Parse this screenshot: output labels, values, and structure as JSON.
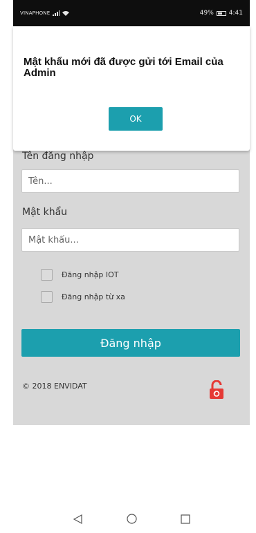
{
  "status_bar": {
    "carrier": "VINAPHONE",
    "battery": "49%",
    "time": "4:41"
  },
  "login": {
    "username_label": "Tên đăng nhập",
    "username_placeholder": "Tên...",
    "password_label": "Mật khẩu",
    "password_placeholder": "Mật khẩu...",
    "checkboxes": [
      {
        "label": "Đăng nhập IOT",
        "checked": false
      },
      {
        "label": "Đăng nhập từ xa",
        "checked": false
      }
    ],
    "submit_label": "Đăng nhập",
    "copyright": "© 2018 ENVIDAT"
  },
  "dialog": {
    "message": "Mật khẩu mới đã được gửi tới Email của Admin",
    "ok_label": "OK"
  },
  "colors": {
    "accent": "#1c9fae",
    "background": "#d8d8d8",
    "unlock_icon": "#e53935"
  },
  "icons": {
    "unlock": "unlock-icon",
    "nav_back": "back-triangle-icon",
    "nav_home": "home-circle-icon",
    "nav_recents": "recents-square-icon"
  }
}
